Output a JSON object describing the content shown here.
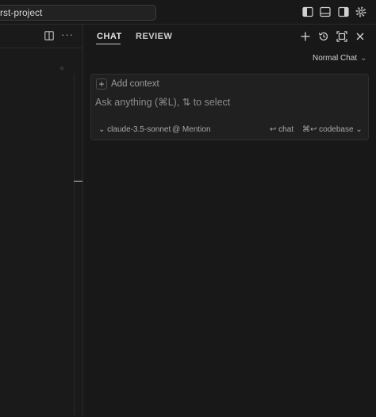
{
  "titlebar": {
    "project_name": "rst-project"
  },
  "icons": {
    "toggle_primary_sidebar": "sidebar-left-icon",
    "toggle_panel": "panel-bottom-icon",
    "toggle_secondary_sidebar": "sidebar-right-icon",
    "settings": "gear-icon"
  },
  "left_pane": {
    "more": "···"
  },
  "chat_panel": {
    "tabs": [
      "CHAT",
      "REVIEW"
    ],
    "mode": "Normal Chat",
    "add_context": "Add context",
    "input_placeholder": "Ask anything (⌘L), ⇅ to select",
    "model": "claude-3.5-sonnet",
    "mention": "@ Mention",
    "chat_action": "↩ chat",
    "codebase_action": "⌘↩ codebase"
  }
}
